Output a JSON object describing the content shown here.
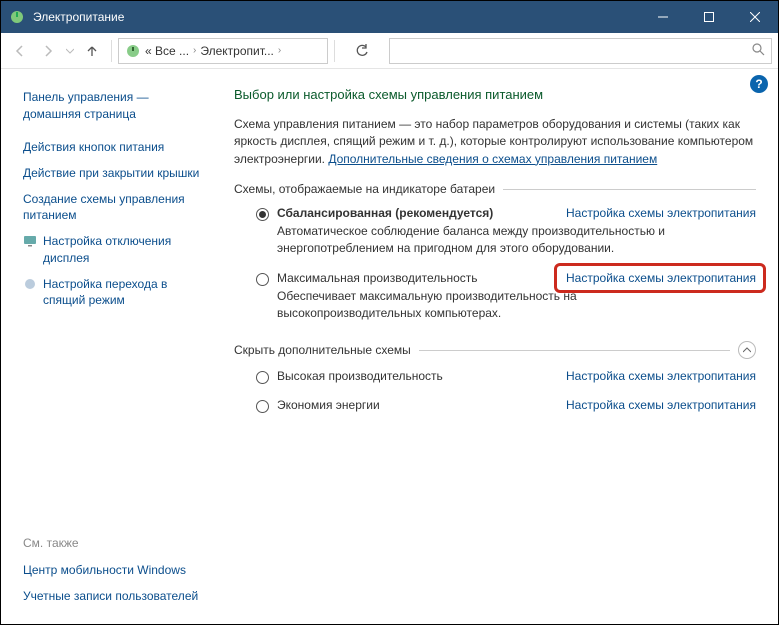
{
  "window": {
    "title": "Электропитание"
  },
  "breadcrumb": {
    "root": "« Все ...",
    "current": "Электропит..."
  },
  "sidebar": {
    "home": "Панель управления — домашняя страница",
    "links": [
      "Действия кнопок питания",
      "Действие при закрытии крышки",
      "Создание схемы управления питанием",
      "Настройка отключения дисплея",
      "Настройка перехода в спящий режим"
    ],
    "see_also_label": "См. также",
    "see_also": [
      "Центр мобильности Windows",
      "Учетные записи пользователей"
    ]
  },
  "main": {
    "heading": "Выбор или настройка схемы управления питанием",
    "intro": "Схема управления питанием — это набор параметров оборудования и системы (таких как яркость дисплея, спящий режим и т. д.), которые контролируют использование компьютером электроэнергии. ",
    "intro_link": "Дополнительные сведения о схемах управления питанием",
    "group1_label": "Схемы, отображаемые на индикаторе батареи",
    "plans": [
      {
        "name": "Сбалансированная (рекомендуется)",
        "desc": "Автоматическое соблюдение баланса между производительностью и энергопотреблением на пригодном для этого оборудовании.",
        "link": "Настройка схемы электропитания"
      },
      {
        "name": "Максимальная производительность",
        "desc": "Обеспечивает максимальную производительность на высокопроизводительных компьютерах.",
        "link": "Настройка схемы электропитания"
      }
    ],
    "group2_label": "Скрыть дополнительные схемы",
    "extra_plans": [
      {
        "name": "Высокая производительность",
        "link": "Настройка схемы электропитания"
      },
      {
        "name": "Экономия энергии",
        "link": "Настройка схемы электропитания"
      }
    ]
  }
}
